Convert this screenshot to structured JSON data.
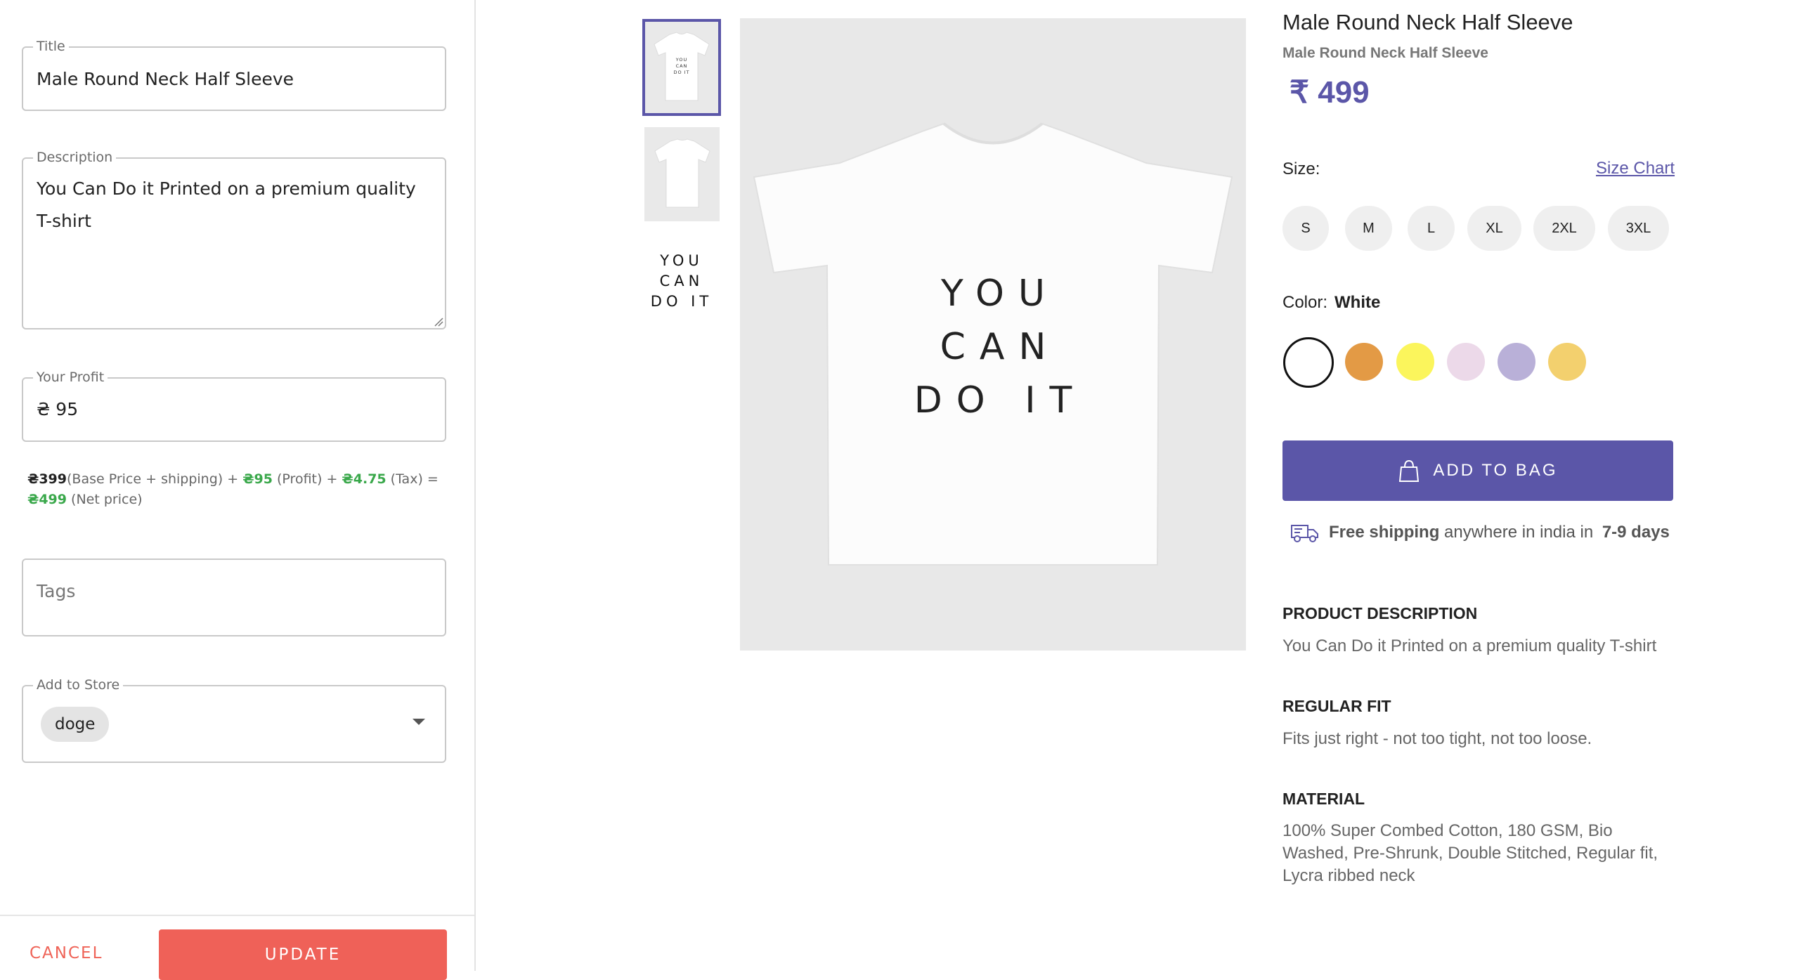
{
  "editor": {
    "title_legend": "Title",
    "title_value": "Male Round Neck Half Sleeve",
    "description_legend": "Description",
    "description_value": "You Can Do it Printed on a premium quality T-shirt",
    "profit_legend": "Your Profit",
    "profit_value": "₴ 95",
    "breakdown": {
      "base_amount": "₴399",
      "base_text": "(Base Price + shipping) + ",
      "profit_amount": "₴95",
      "profit_text": " (Profit) + ",
      "tax_amount": "₴4.75",
      "tax_text": " (Tax) =",
      "net_amount": "₴499",
      "net_text": " (Net price)"
    },
    "tags_placeholder": "Tags",
    "store_legend": "Add to Store",
    "store_chip": "doge",
    "cancel_label": "CANCEL",
    "update_label": "UPDATE"
  },
  "preview": {
    "print_text": [
      "YOU",
      "CAN",
      "DO IT"
    ],
    "thumb_print": [
      "YOU",
      "CAN",
      "DO IT"
    ],
    "thumb_text": [
      "YOU",
      "CAN",
      "DO IT"
    ]
  },
  "product": {
    "title": "Male Round Neck Half Sleeve",
    "subtitle": "Male Round Neck Half Sleeve",
    "price": "₹ 499",
    "size_label": "Size:",
    "size_chart": "Size Chart",
    "sizes": [
      "S",
      "M",
      "L",
      "XL",
      "2XL",
      "3XL"
    ],
    "color_label": "Color:",
    "color_selected": "White",
    "colors": [
      "#ffffff",
      "#e39a45",
      "#fbf55c",
      "#ecd9e9",
      "#b9b0d8",
      "#f3d06e"
    ],
    "add_to_bag": "ADD TO BAG",
    "shipping": {
      "bold1": "Free shipping",
      "middle": " anywhere in india in ",
      "bold2": "7-9 days"
    },
    "sections": [
      {
        "heading": "PRODUCT DESCRIPTION",
        "text": "You Can Do it Printed on a premium quality T-shirt"
      },
      {
        "heading": "REGULAR FIT",
        "text": "Fits just right - not too tight, not too loose."
      },
      {
        "heading": "MATERIAL",
        "text": "100% Super Combed Cotton, 180 GSM, Bio Washed, Pre-Shrunk, Double Stitched, Regular fit, Lycra ribbed neck"
      }
    ],
    "accent_color": "#5b56a8",
    "update_color": "#ef6158"
  }
}
